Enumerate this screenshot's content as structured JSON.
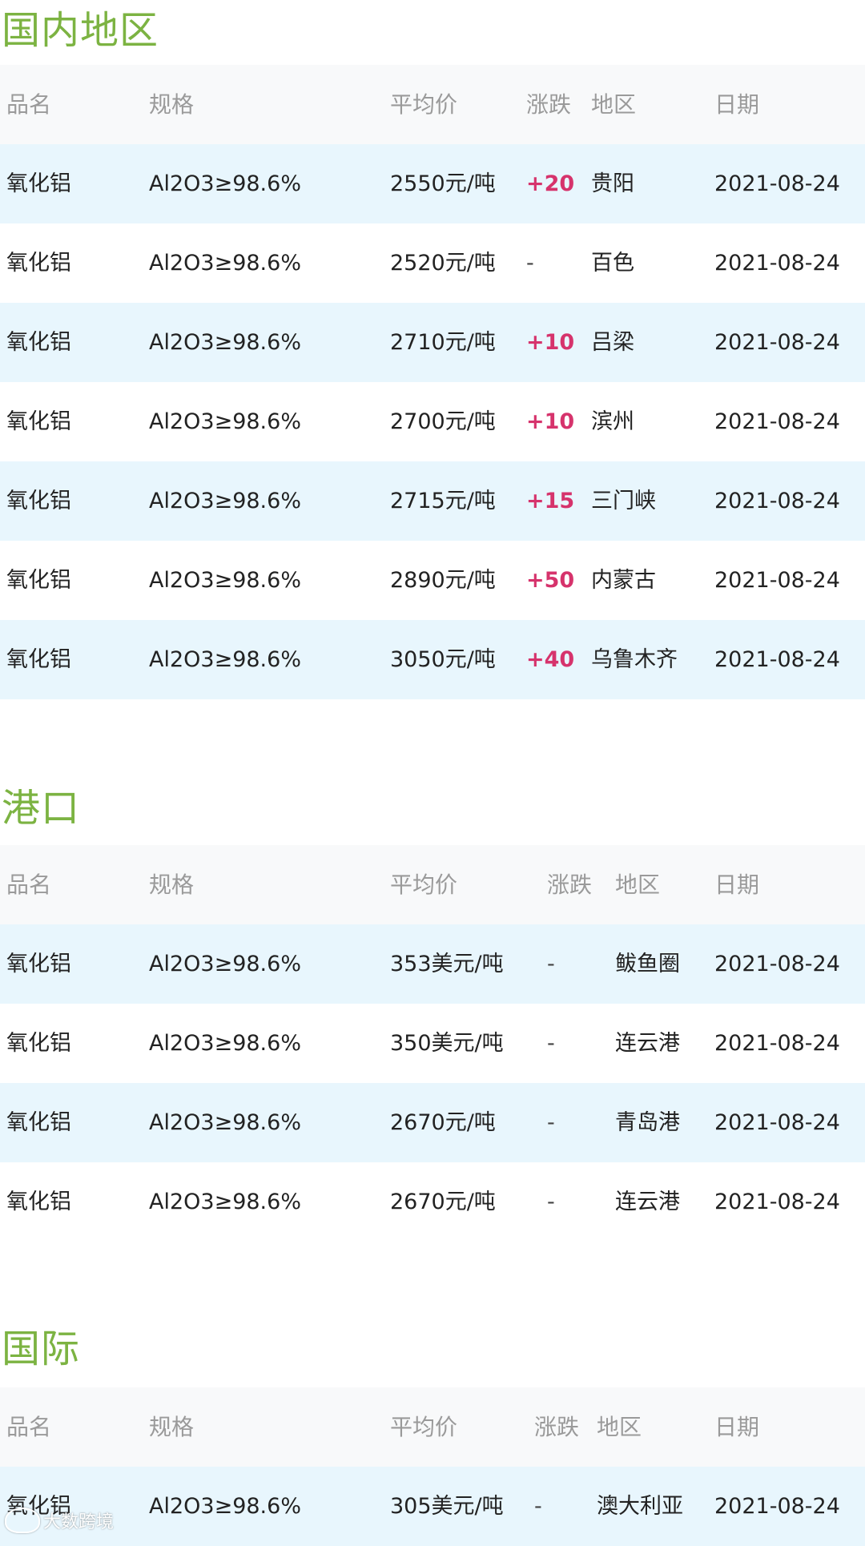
{
  "colors": {
    "title": "#7cb342",
    "up": "#d6336c",
    "header_bg": "#f8f9fa",
    "tint_bg": "#e8f6fd"
  },
  "sections": [
    {
      "title": "国内地区",
      "headers": [
        "品名",
        "规格",
        "平均价",
        "涨跌",
        "地区",
        "日期"
      ],
      "rows": [
        [
          "氧化铝",
          "Al2O3≥98.6%",
          "2550元/吨",
          "+20",
          "贵阳",
          "2021-08-24"
        ],
        [
          "氧化铝",
          "Al2O3≥98.6%",
          "2520元/吨",
          "-",
          "百色",
          "2021-08-24"
        ],
        [
          "氧化铝",
          "Al2O3≥98.6%",
          "2710元/吨",
          "+10",
          "吕梁",
          "2021-08-24"
        ],
        [
          "氧化铝",
          "Al2O3≥98.6%",
          "2700元/吨",
          "+10",
          "滨州",
          "2021-08-24"
        ],
        [
          "氧化铝",
          "Al2O3≥98.6%",
          "2715元/吨",
          "+15",
          "三门峡",
          "2021-08-24"
        ],
        [
          "氧化铝",
          "Al2O3≥98.6%",
          "2890元/吨",
          "+50",
          "内蒙古",
          "2021-08-24"
        ],
        [
          "氧化铝",
          "Al2O3≥98.6%",
          "3050元/吨",
          "+40",
          "乌鲁木齐",
          "2021-08-24"
        ]
      ]
    },
    {
      "title": "港口",
      "headers": [
        "品名",
        "规格",
        "平均价",
        "涨跌",
        "地区",
        "日期"
      ],
      "rows": [
        [
          "氧化铝",
          "Al2O3≥98.6%",
          "353美元/吨",
          "-",
          "鲅鱼圈",
          "2021-08-24"
        ],
        [
          "氧化铝",
          "Al2O3≥98.6%",
          "350美元/吨",
          "-",
          "连云港",
          "2021-08-24"
        ],
        [
          "氧化铝",
          "Al2O3≥98.6%",
          "2670元/吨",
          "-",
          "青岛港",
          "2021-08-24"
        ],
        [
          "氧化铝",
          "Al2O3≥98.6%",
          "2670元/吨",
          "-",
          "连云港",
          "2021-08-24"
        ]
      ]
    },
    {
      "title": "国际",
      "headers": [
        "品名",
        "规格",
        "平均价",
        "涨跌",
        "地区",
        "日期"
      ],
      "rows": [
        [
          "氧化铝",
          "Al2O3≥98.6%",
          "305美元/吨",
          "-",
          "澳大利亚",
          "2021-08-24"
        ]
      ]
    }
  ],
  "watermark": "大数跨境"
}
